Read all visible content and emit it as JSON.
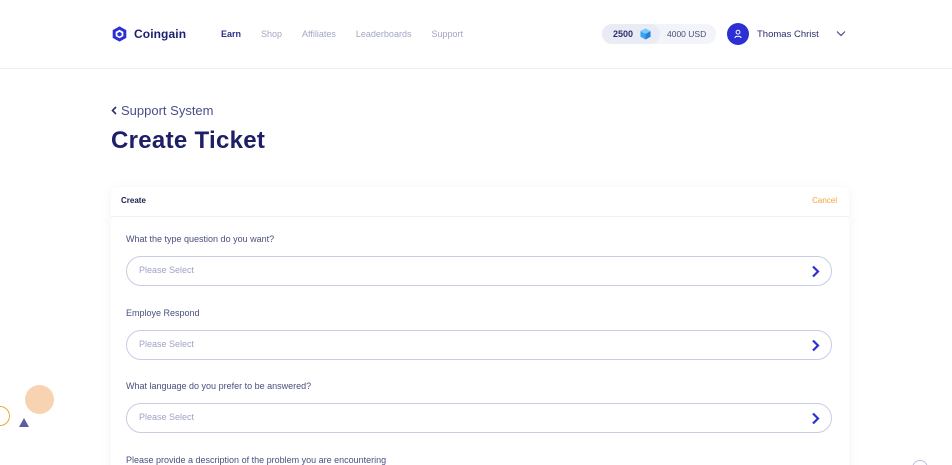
{
  "brand": {
    "name": "Coingain",
    "logo_icon": "hexagon-cube-logo"
  },
  "nav": {
    "items": [
      {
        "label": "Earn",
        "active": true
      },
      {
        "label": "Shop",
        "active": false
      },
      {
        "label": "Affiliates",
        "active": false
      },
      {
        "label": "Leaderboards",
        "active": false
      },
      {
        "label": "Support",
        "active": false
      }
    ]
  },
  "wallet": {
    "coins": "2500",
    "coin_icon": "gem-icon",
    "usd": "4000 USD"
  },
  "user": {
    "name": "Thomas Christ",
    "avatar_icon": "user-icon",
    "menu_icon": "chevron-down-icon"
  },
  "page": {
    "back_label": "Support System",
    "title": "Create Ticket"
  },
  "card": {
    "title": "Create",
    "cancel_label": "Cancel",
    "fields": [
      {
        "label": "What the type question do you want?",
        "placeholder": "Please Select"
      },
      {
        "label": "Employe Respond",
        "placeholder": "Please Select"
      },
      {
        "label": "What language do you prefer to be answered?",
        "placeholder": "Please Select"
      },
      {
        "label": "Please provide a description of the problem you are encountering"
      }
    ]
  },
  "colors": {
    "accent": "#2c2fd4",
    "brand_navy": "#1d2066",
    "cancel": "#f5a23a",
    "muted": "#a3a6c4"
  }
}
